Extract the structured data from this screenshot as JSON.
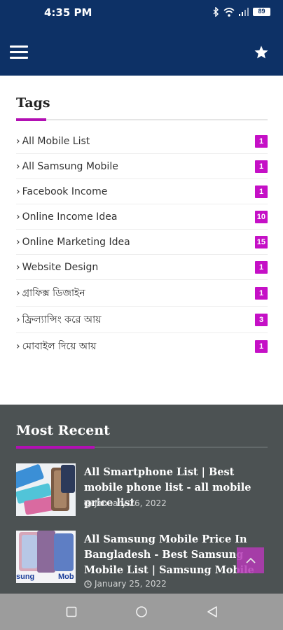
{
  "status_bar": {
    "time": "4:35 PM",
    "battery": "89"
  },
  "app_bar": {
    "menu_icon": "hamburger-menu-icon",
    "favorite_icon": "star-icon"
  },
  "tags": {
    "title": "Tags",
    "items": [
      {
        "label": "All Mobile List",
        "count": "1"
      },
      {
        "label": "All Samsung Mobile",
        "count": "1"
      },
      {
        "label": "Facebook Income",
        "count": "1"
      },
      {
        "label": "Online Income Idea",
        "count": "10"
      },
      {
        "label": "Online Marketing Idea",
        "count": "15"
      },
      {
        "label": "Website Design",
        "count": "1"
      },
      {
        "label": "গ্রাফিক্স ডিজাইন",
        "count": "1"
      },
      {
        "label": "ফ্রিল্যান্সিং করে আয়",
        "count": "3"
      },
      {
        "label": "মোবাইল দিয়ে আয়",
        "count": "1"
      }
    ]
  },
  "recent": {
    "title": "Most Recent",
    "posts": [
      {
        "title": "All Smartphone List | Best mobile phone list - all mobile price list",
        "date": "January 26, 2022"
      },
      {
        "title": "All Samsung Mobile Price In Bangladesh - Best Samsung Mobile List | Samsung Mobile",
        "date": "January 25, 2022"
      }
    ],
    "thumb2_text_left": "sung",
    "thumb2_text_right": "Mob"
  },
  "colors": {
    "header": "#0d3166",
    "accent": "#c510c6",
    "recent_bg": "#4c5253"
  }
}
